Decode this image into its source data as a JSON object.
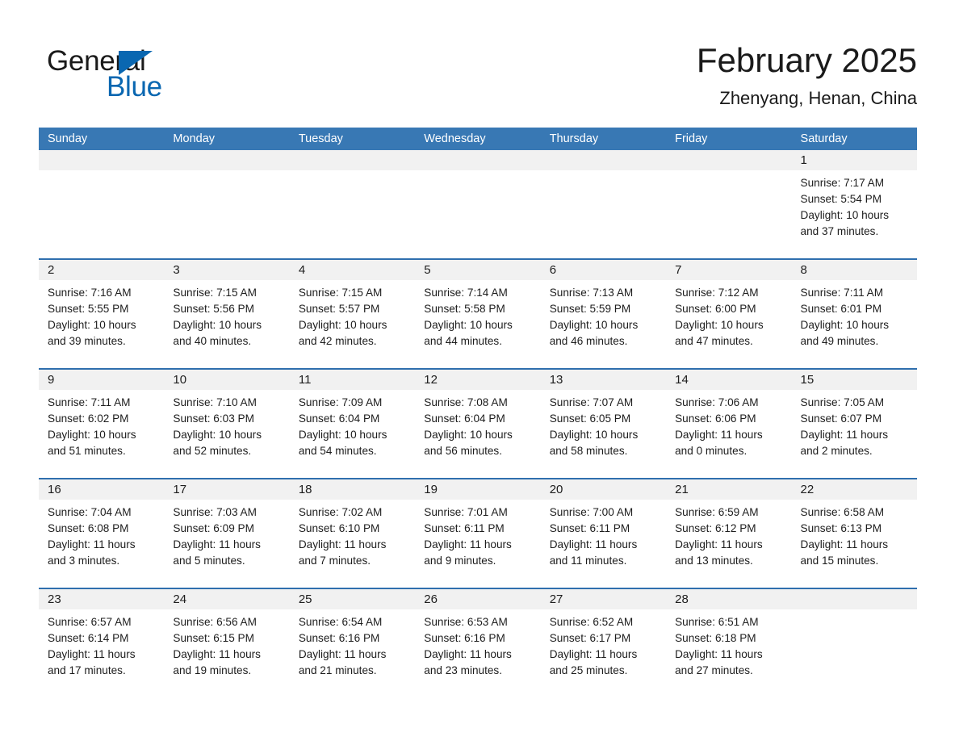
{
  "logo": {
    "word1": "General",
    "word2": "Blue",
    "triangle_color": "#0a67b1"
  },
  "header": {
    "month_title": "February 2025",
    "location": "Zhenyang, Henan, China"
  },
  "theme": {
    "header_blue": "#3878b4",
    "row_divider_blue": "#2f6fae",
    "daynum_band": "#f1f1f1",
    "text": "#1d1d1d"
  },
  "calendar": {
    "weekday_headers": [
      "Sunday",
      "Monday",
      "Tuesday",
      "Wednesday",
      "Thursday",
      "Friday",
      "Saturday"
    ],
    "weeks": [
      [
        {
          "day": "",
          "sunrise": "",
          "sunset": "",
          "daylight_line1": "",
          "daylight_line2": ""
        },
        {
          "day": "",
          "sunrise": "",
          "sunset": "",
          "daylight_line1": "",
          "daylight_line2": ""
        },
        {
          "day": "",
          "sunrise": "",
          "sunset": "",
          "daylight_line1": "",
          "daylight_line2": ""
        },
        {
          "day": "",
          "sunrise": "",
          "sunset": "",
          "daylight_line1": "",
          "daylight_line2": ""
        },
        {
          "day": "",
          "sunrise": "",
          "sunset": "",
          "daylight_line1": "",
          "daylight_line2": ""
        },
        {
          "day": "",
          "sunrise": "",
          "sunset": "",
          "daylight_line1": "",
          "daylight_line2": ""
        },
        {
          "day": "1",
          "sunrise": "Sunrise: 7:17 AM",
          "sunset": "Sunset: 5:54 PM",
          "daylight_line1": "Daylight: 10 hours",
          "daylight_line2": "and 37 minutes."
        }
      ],
      [
        {
          "day": "2",
          "sunrise": "Sunrise: 7:16 AM",
          "sunset": "Sunset: 5:55 PM",
          "daylight_line1": "Daylight: 10 hours",
          "daylight_line2": "and 39 minutes."
        },
        {
          "day": "3",
          "sunrise": "Sunrise: 7:15 AM",
          "sunset": "Sunset: 5:56 PM",
          "daylight_line1": "Daylight: 10 hours",
          "daylight_line2": "and 40 minutes."
        },
        {
          "day": "4",
          "sunrise": "Sunrise: 7:15 AM",
          "sunset": "Sunset: 5:57 PM",
          "daylight_line1": "Daylight: 10 hours",
          "daylight_line2": "and 42 minutes."
        },
        {
          "day": "5",
          "sunrise": "Sunrise: 7:14 AM",
          "sunset": "Sunset: 5:58 PM",
          "daylight_line1": "Daylight: 10 hours",
          "daylight_line2": "and 44 minutes."
        },
        {
          "day": "6",
          "sunrise": "Sunrise: 7:13 AM",
          "sunset": "Sunset: 5:59 PM",
          "daylight_line1": "Daylight: 10 hours",
          "daylight_line2": "and 46 minutes."
        },
        {
          "day": "7",
          "sunrise": "Sunrise: 7:12 AM",
          "sunset": "Sunset: 6:00 PM",
          "daylight_line1": "Daylight: 10 hours",
          "daylight_line2": "and 47 minutes."
        },
        {
          "day": "8",
          "sunrise": "Sunrise: 7:11 AM",
          "sunset": "Sunset: 6:01 PM",
          "daylight_line1": "Daylight: 10 hours",
          "daylight_line2": "and 49 minutes."
        }
      ],
      [
        {
          "day": "9",
          "sunrise": "Sunrise: 7:11 AM",
          "sunset": "Sunset: 6:02 PM",
          "daylight_line1": "Daylight: 10 hours",
          "daylight_line2": "and 51 minutes."
        },
        {
          "day": "10",
          "sunrise": "Sunrise: 7:10 AM",
          "sunset": "Sunset: 6:03 PM",
          "daylight_line1": "Daylight: 10 hours",
          "daylight_line2": "and 52 minutes."
        },
        {
          "day": "11",
          "sunrise": "Sunrise: 7:09 AM",
          "sunset": "Sunset: 6:04 PM",
          "daylight_line1": "Daylight: 10 hours",
          "daylight_line2": "and 54 minutes."
        },
        {
          "day": "12",
          "sunrise": "Sunrise: 7:08 AM",
          "sunset": "Sunset: 6:04 PM",
          "daylight_line1": "Daylight: 10 hours",
          "daylight_line2": "and 56 minutes."
        },
        {
          "day": "13",
          "sunrise": "Sunrise: 7:07 AM",
          "sunset": "Sunset: 6:05 PM",
          "daylight_line1": "Daylight: 10 hours",
          "daylight_line2": "and 58 minutes."
        },
        {
          "day": "14",
          "sunrise": "Sunrise: 7:06 AM",
          "sunset": "Sunset: 6:06 PM",
          "daylight_line1": "Daylight: 11 hours",
          "daylight_line2": "and 0 minutes."
        },
        {
          "day": "15",
          "sunrise": "Sunrise: 7:05 AM",
          "sunset": "Sunset: 6:07 PM",
          "daylight_line1": "Daylight: 11 hours",
          "daylight_line2": "and 2 minutes."
        }
      ],
      [
        {
          "day": "16",
          "sunrise": "Sunrise: 7:04 AM",
          "sunset": "Sunset: 6:08 PM",
          "daylight_line1": "Daylight: 11 hours",
          "daylight_line2": "and 3 minutes."
        },
        {
          "day": "17",
          "sunrise": "Sunrise: 7:03 AM",
          "sunset": "Sunset: 6:09 PM",
          "daylight_line1": "Daylight: 11 hours",
          "daylight_line2": "and 5 minutes."
        },
        {
          "day": "18",
          "sunrise": "Sunrise: 7:02 AM",
          "sunset": "Sunset: 6:10 PM",
          "daylight_line1": "Daylight: 11 hours",
          "daylight_line2": "and 7 minutes."
        },
        {
          "day": "19",
          "sunrise": "Sunrise: 7:01 AM",
          "sunset": "Sunset: 6:11 PM",
          "daylight_line1": "Daylight: 11 hours",
          "daylight_line2": "and 9 minutes."
        },
        {
          "day": "20",
          "sunrise": "Sunrise: 7:00 AM",
          "sunset": "Sunset: 6:11 PM",
          "daylight_line1": "Daylight: 11 hours",
          "daylight_line2": "and 11 minutes."
        },
        {
          "day": "21",
          "sunrise": "Sunrise: 6:59 AM",
          "sunset": "Sunset: 6:12 PM",
          "daylight_line1": "Daylight: 11 hours",
          "daylight_line2": "and 13 minutes."
        },
        {
          "day": "22",
          "sunrise": "Sunrise: 6:58 AM",
          "sunset": "Sunset: 6:13 PM",
          "daylight_line1": "Daylight: 11 hours",
          "daylight_line2": "and 15 minutes."
        }
      ],
      [
        {
          "day": "23",
          "sunrise": "Sunrise: 6:57 AM",
          "sunset": "Sunset: 6:14 PM",
          "daylight_line1": "Daylight: 11 hours",
          "daylight_line2": "and 17 minutes."
        },
        {
          "day": "24",
          "sunrise": "Sunrise: 6:56 AM",
          "sunset": "Sunset: 6:15 PM",
          "daylight_line1": "Daylight: 11 hours",
          "daylight_line2": "and 19 minutes."
        },
        {
          "day": "25",
          "sunrise": "Sunrise: 6:54 AM",
          "sunset": "Sunset: 6:16 PM",
          "daylight_line1": "Daylight: 11 hours",
          "daylight_line2": "and 21 minutes."
        },
        {
          "day": "26",
          "sunrise": "Sunrise: 6:53 AM",
          "sunset": "Sunset: 6:16 PM",
          "daylight_line1": "Daylight: 11 hours",
          "daylight_line2": "and 23 minutes."
        },
        {
          "day": "27",
          "sunrise": "Sunrise: 6:52 AM",
          "sunset": "Sunset: 6:17 PM",
          "daylight_line1": "Daylight: 11 hours",
          "daylight_line2": "and 25 minutes."
        },
        {
          "day": "28",
          "sunrise": "Sunrise: 6:51 AM",
          "sunset": "Sunset: 6:18 PM",
          "daylight_line1": "Daylight: 11 hours",
          "daylight_line2": "and 27 minutes."
        },
        {
          "day": "",
          "sunrise": "",
          "sunset": "",
          "daylight_line1": "",
          "daylight_line2": ""
        }
      ]
    ]
  }
}
